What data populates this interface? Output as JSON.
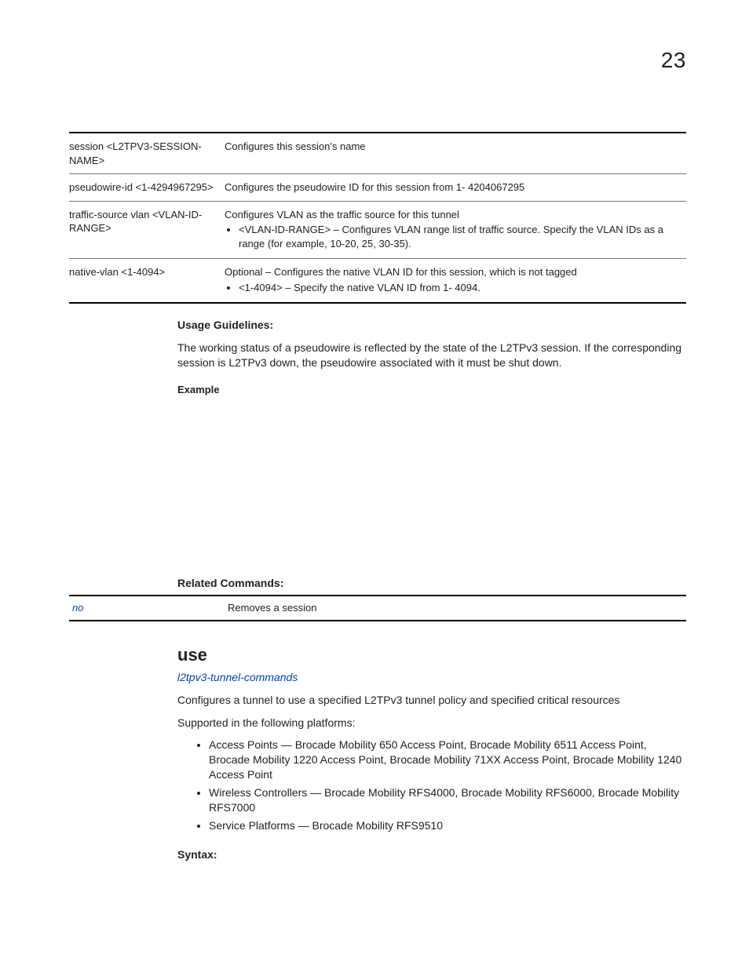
{
  "page_number": "23",
  "params_table": {
    "rows": [
      {
        "param": "session <L2TPV3-SESSION-NAME>",
        "desc": "Configures this session's name"
      },
      {
        "param": "pseudowire-id <1-4294967295>",
        "desc": "Configures the pseudowire ID for this session from 1- 4204067295"
      },
      {
        "param": "traffic-source vlan <VLAN-ID-RANGE>",
        "desc": "Configures VLAN as the traffic source for this tunnel",
        "bullets": [
          "<VLAN-ID-RANGE> – Configures VLAN range list of traffic source. Specify the VLAN IDs as a range (for example, 10-20, 25, 30-35)."
        ]
      },
      {
        "param": "native-vlan <1-4094>",
        "desc": "Optional – Configures the native VLAN ID for this session, which is not tagged",
        "bullets": [
          "<1-4094> – Specify the native VLAN ID from 1- 4094."
        ]
      }
    ]
  },
  "usage": {
    "heading": "Usage Guidelines:",
    "text": "The working status of a pseudowire is reflected by the state of the L2TPv3 session. If the corresponding session is L2TPv3 down, the pseudowire associated with it must be shut down."
  },
  "example_heading": "Example",
  "related": {
    "heading": "Related Commands:",
    "cmd": "no",
    "desc": "Removes a session"
  },
  "use_section": {
    "title": "use",
    "category_link": "l2tpv3-tunnel-commands",
    "intro": "Configures a tunnel to use a specified L2TPv3 tunnel policy and specified critical resources",
    "supported_intro": "Supported in the following platforms:",
    "platforms": [
      "Access Points — Brocade Mobility 650 Access Point, Brocade Mobility 6511 Access Point, Brocade Mobility 1220 Access Point, Brocade Mobility 71XX Access Point, Brocade Mobility 1240 Access Point",
      "Wireless Controllers — Brocade Mobility RFS4000, Brocade Mobility RFS6000, Brocade Mobility RFS7000",
      "Service Platforms — Brocade Mobility RFS9510"
    ],
    "syntax_heading": "Syntax:"
  }
}
